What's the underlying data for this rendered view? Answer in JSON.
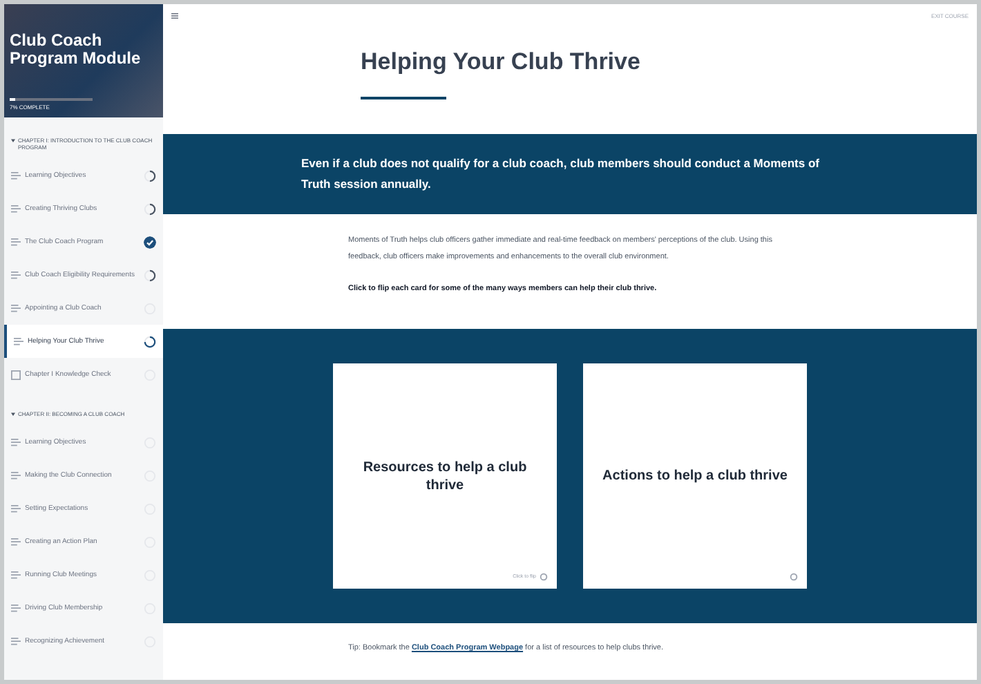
{
  "course": {
    "title": "Club Coach Program Module",
    "progress_text": "7% COMPLETE",
    "level": 0.07
  },
  "sidebar": {
    "chapters": [
      {
        "title": "CHAPTER I: INTRODUCTION TO THE CLUB COACH PROGRAM",
        "expanded": true,
        "lessons": [
          {
            "kind": "lesson",
            "title": "Learning Objectives",
            "started": true,
            "completed": false,
            "selected": false
          },
          {
            "kind": "lesson",
            "title": "Creating Thriving Clubs",
            "started": true,
            "completed": false,
            "selected": false
          },
          {
            "kind": "lesson",
            "title": "The Club Coach Program",
            "completed": true,
            "selected": false
          },
          {
            "kind": "lesson",
            "title": "Club Coach Eligibility Requirements",
            "started": true,
            "completed": false,
            "selected": false
          },
          {
            "kind": "lesson",
            "title": "Appointing a Club Coach",
            "started": false,
            "completed": false,
            "selected": false
          },
          {
            "kind": "lesson",
            "title": "Helping Your Club Thrive",
            "started": true,
            "completed": false,
            "selected": true
          },
          {
            "kind": "quiz",
            "title": "Chapter I Knowledge Check",
            "started": false,
            "completed": false,
            "selected": false
          }
        ]
      },
      {
        "title": "CHAPTER II: BECOMING A CLUB COACH",
        "expanded": true,
        "lessons": [
          {
            "kind": "lesson",
            "title": "Learning Objectives",
            "started": false,
            "completed": false,
            "selected": false
          },
          {
            "kind": "lesson",
            "title": "Making the Club Connection",
            "started": false,
            "completed": false,
            "selected": false
          },
          {
            "kind": "lesson",
            "title": "Setting Expectations",
            "started": false,
            "completed": false,
            "selected": false
          },
          {
            "kind": "lesson",
            "title": "Creating an Action Plan",
            "started": false,
            "completed": false,
            "selected": false
          },
          {
            "kind": "lesson",
            "title": "Running Club Meetings",
            "started": false,
            "completed": false,
            "selected": false
          },
          {
            "kind": "lesson",
            "title": "Driving Club Membership",
            "started": false,
            "completed": false,
            "selected": false
          },
          {
            "kind": "lesson",
            "title": "Recognizing Achievement",
            "started": false,
            "completed": false,
            "selected": false
          }
        ]
      }
    ]
  },
  "topbar": {
    "exit": "EXIT COURSE"
  },
  "lesson": {
    "title": "Helping Your Club Thrive",
    "banner": "Even if a club does not qualify for a club coach, club members should conduct a Moments of Truth session annually.",
    "paragraph": "Moments of Truth helps club officers gather immediate and real-time feedback on members' perceptions of the club. Using this feedback, club officers make improvements and enhancements to the overall club environment.",
    "instruction": "Click to flip each card for some of the many ways members can help their club thrive.",
    "cards": [
      {
        "title": "Resources to help a club thrive",
        "hint": "Click to flip"
      },
      {
        "title": "Actions to help a club thrive"
      }
    ],
    "tip": {
      "before": "Tip: Bookmark the ",
      "link": "Club Coach Program Webpage",
      "after": " for a list of resources to help clubs thrive."
    }
  }
}
